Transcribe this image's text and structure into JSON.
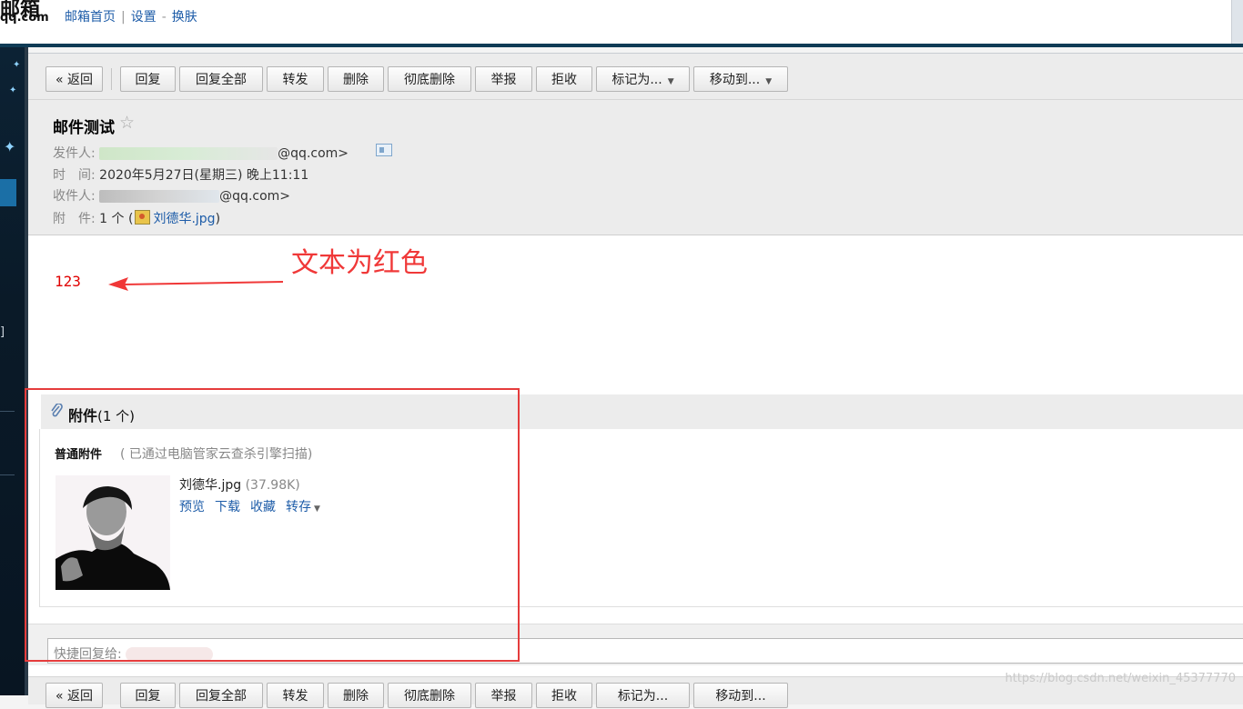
{
  "header": {
    "logo_top": "邮箱",
    "logo_bottom": "qq.com",
    "links": [
      "邮箱首页",
      "设置",
      "换肤"
    ]
  },
  "sidebar": {
    "fragment": "]"
  },
  "toolbar": {
    "buttons": [
      "« 返回",
      "回复",
      "回复全部",
      "转发",
      "删除",
      "彻底删除",
      "举报",
      "拒收",
      "标记为...",
      "移动到..."
    ]
  },
  "mail": {
    "subject": "邮件测试",
    "star_icon": "☆",
    "sender_label": "发件人:",
    "sender_suffix": "@qq.com>",
    "time_label": "时　间:",
    "time_value": "2020年5月27日(星期三) 晚上11:11",
    "recipient_label": "收件人:",
    "recipient_suffix": "@qq.com>",
    "attach_label": "附　件:",
    "attach_count": "1 个 (",
    "attach_name": "刘德华.jpg",
    "attach_close": ")"
  },
  "body": {
    "text": "123",
    "text_color": "#e00000",
    "annotation": "文本为红色",
    "annotation_color": "#f03838"
  },
  "attachments": {
    "title": "附件",
    "count": "(1 个)",
    "type_label": "普通附件",
    "scan_note": "(  已通过电脑管家云查杀引擎扫描)",
    "file_name": "刘德华.jpg",
    "file_size": "(37.98K)",
    "actions": [
      "预览",
      "下载",
      "收藏",
      "转存"
    ]
  },
  "quick_reply": {
    "placeholder": "快捷回复给:"
  },
  "watermark": "https://blog.csdn.net/weixin_45377770",
  "colors": {
    "link": "#1d5ca8",
    "highlight_box": "#e53c3c"
  }
}
